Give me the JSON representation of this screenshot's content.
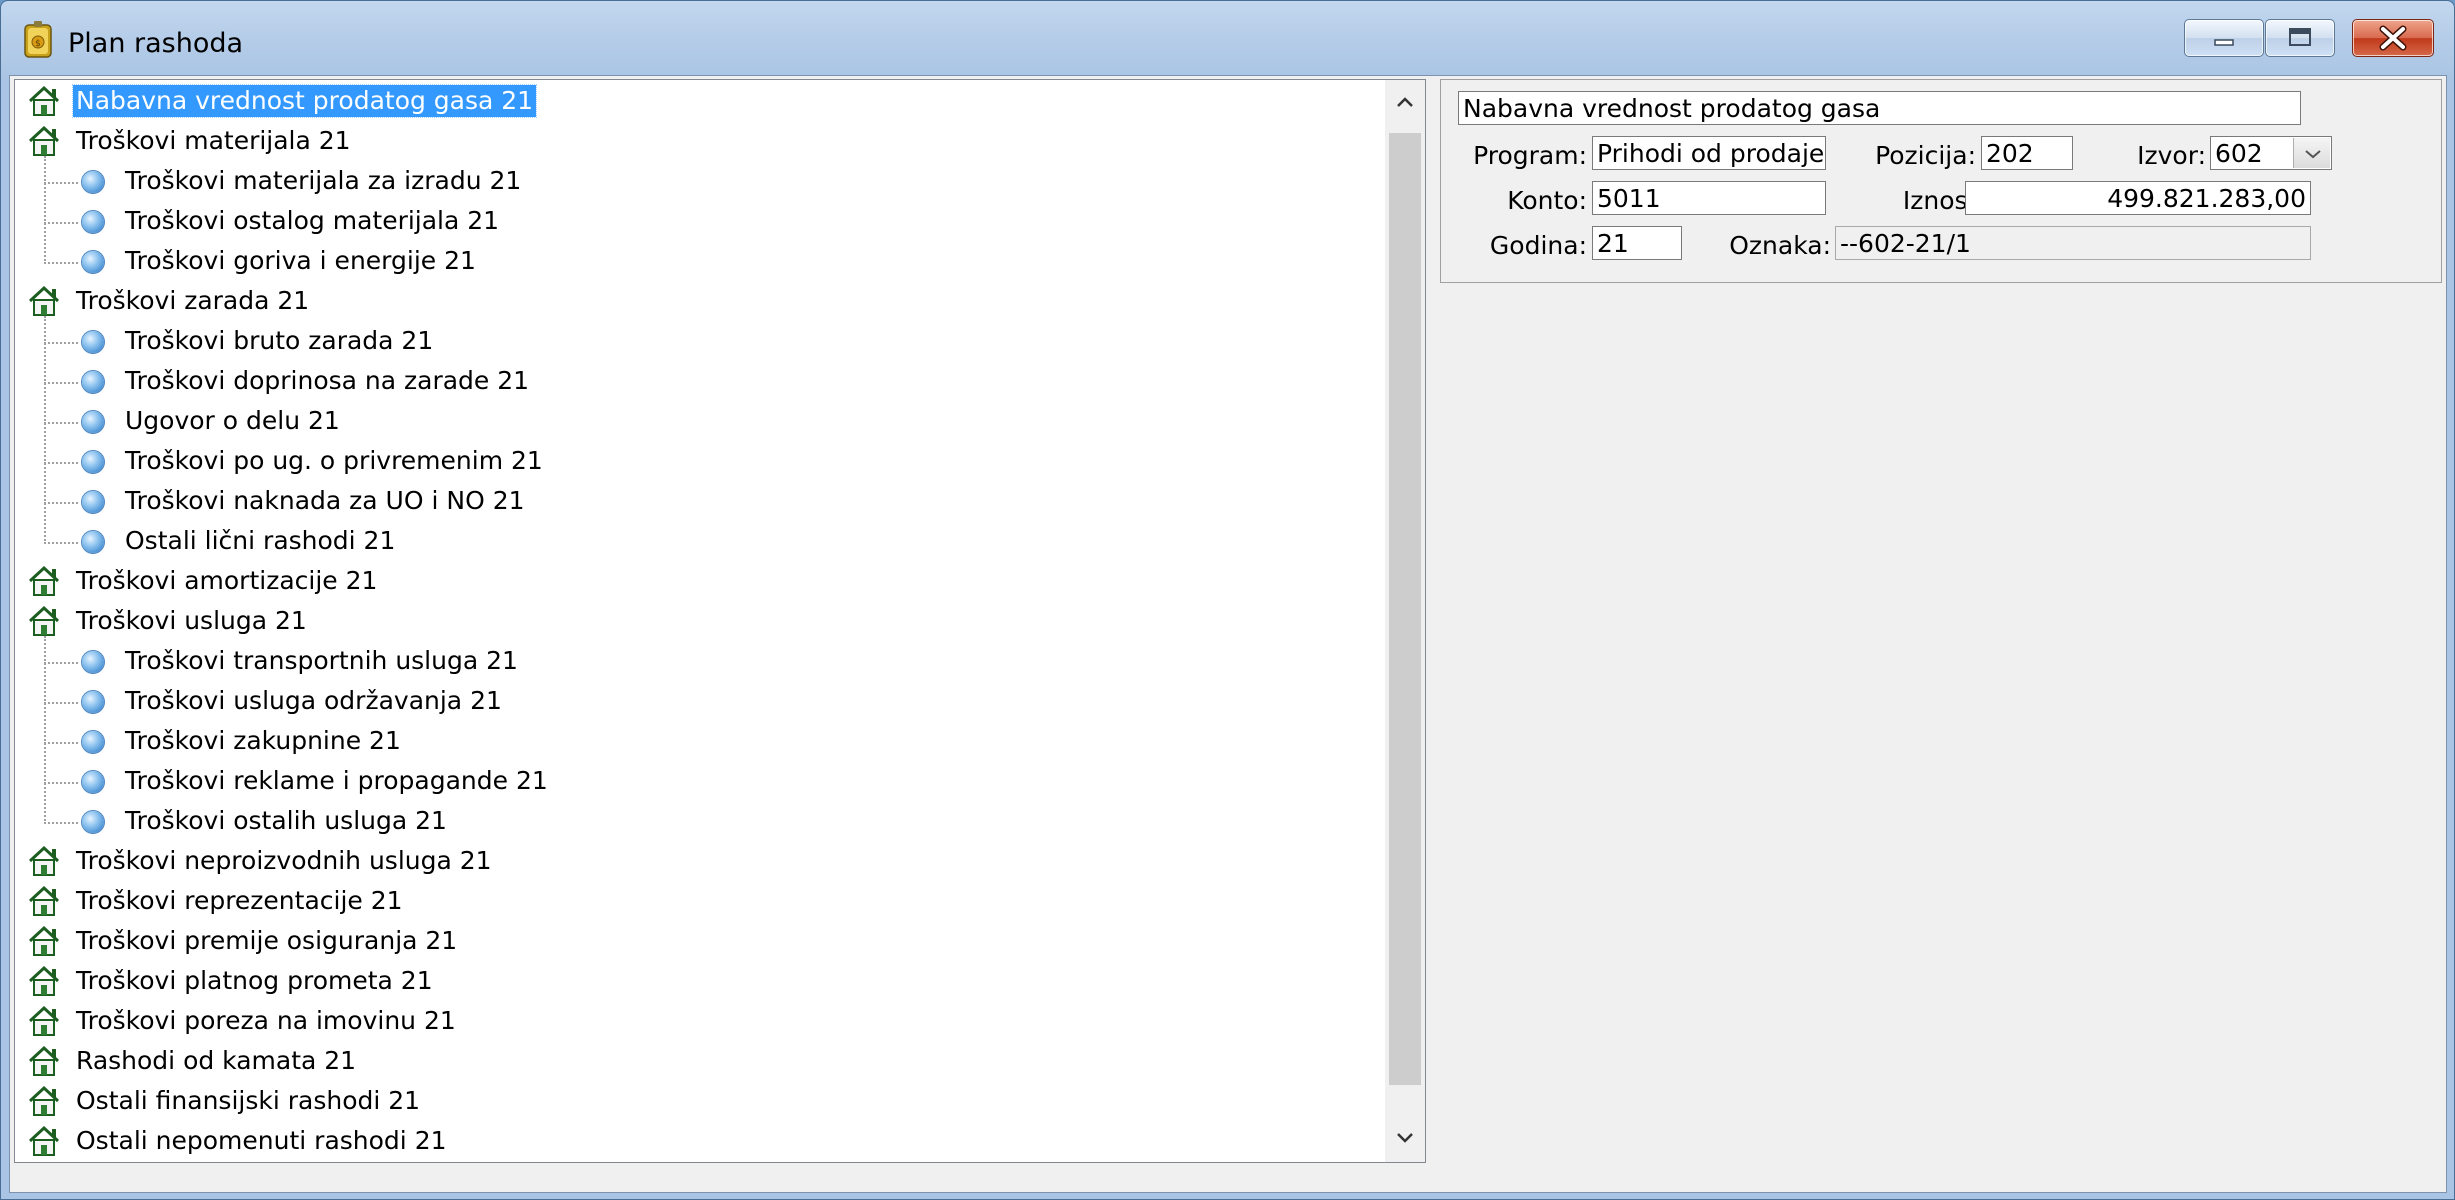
{
  "window": {
    "title": "Plan rashoda",
    "controls": [
      "minimize-icon",
      "maximize-icon",
      "close-icon"
    ]
  },
  "tree": {
    "selected_index": 0,
    "items": [
      {
        "label": "Nabavna vrednost prodatog gasa 21",
        "level": 0,
        "icon": "house-icon"
      },
      {
        "label": "Troškovi materijala 21",
        "level": 0,
        "icon": "house-icon"
      },
      {
        "label": "Troškovi materijala za izradu  21",
        "level": 1,
        "icon": "bullet-icon"
      },
      {
        "label": "Troškovi ostalog materijala 21",
        "level": 1,
        "icon": "bullet-icon"
      },
      {
        "label": "Troškovi goriva i energije 21",
        "level": 1,
        "icon": "bullet-icon"
      },
      {
        "label": "Troškovi zarada 21",
        "level": 0,
        "icon": "house-icon"
      },
      {
        "label": "Troškovi bruto zarada 21",
        "level": 1,
        "icon": "bullet-icon"
      },
      {
        "label": "Troškovi doprinosa na zarade 21",
        "level": 1,
        "icon": "bullet-icon"
      },
      {
        "label": "Ugovor o delu 21",
        "level": 1,
        "icon": "bullet-icon"
      },
      {
        "label": "Troškovi po ug. o privremenim 21",
        "level": 1,
        "icon": "bullet-icon"
      },
      {
        "label": "Troškovi naknada za UO i NO 21",
        "level": 1,
        "icon": "bullet-icon"
      },
      {
        "label": "Ostali lični rashodi 21",
        "level": 1,
        "icon": "bullet-icon"
      },
      {
        "label": "Troškovi amortizacije 21",
        "level": 0,
        "icon": "house-icon"
      },
      {
        "label": "Troškovi usluga 21",
        "level": 0,
        "icon": "house-icon"
      },
      {
        "label": "Troškovi transportnih usluga 21",
        "level": 1,
        "icon": "bullet-icon"
      },
      {
        "label": "Troškovi usluga održavanja 21",
        "level": 1,
        "icon": "bullet-icon"
      },
      {
        "label": "Troškovi zakupnine 21",
        "level": 1,
        "icon": "bullet-icon"
      },
      {
        "label": "Troškovi reklame i propagande 21",
        "level": 1,
        "icon": "bullet-icon"
      },
      {
        "label": "Troškovi ostalih usluga 21",
        "level": 1,
        "icon": "bullet-icon"
      },
      {
        "label": "Troškovi neproizvodnih usluga 21",
        "level": 0,
        "icon": "house-icon"
      },
      {
        "label": "Troškovi reprezentacije 21",
        "level": 0,
        "icon": "house-icon"
      },
      {
        "label": "Troškovi premije osiguranja 21",
        "level": 0,
        "icon": "house-icon"
      },
      {
        "label": "Troškovi platnog prometa 21",
        "level": 0,
        "icon": "house-icon"
      },
      {
        "label": "Troškovi poreza na imovinu 21",
        "level": 0,
        "icon": "house-icon"
      },
      {
        "label": "Rashodi od kamata 21",
        "level": 0,
        "icon": "house-icon"
      },
      {
        "label": "Ostali finansijski rashodi 21",
        "level": 0,
        "icon": "house-icon"
      },
      {
        "label": "Ostali nepomenuti rashodi 21",
        "level": 0,
        "icon": "house-icon"
      }
    ]
  },
  "details": {
    "name": "Nabavna vrednost prodatog gasa",
    "program_label": "Program:",
    "program_value": "Prihodi od prodaje",
    "pozicija_label": "Pozicija:",
    "pozicija_value": "202",
    "izvor_label": "Izvor:",
    "izvor_value": "602",
    "konto_label": "Konto:",
    "konto_value": "5011",
    "iznos_label": "Iznos:",
    "iznos_value": "499.821.283,00",
    "godina_label": "Godina:",
    "godina_value": "21",
    "oznaka_label": "Oznaka:",
    "oznaka_value": "--602-21/1"
  }
}
